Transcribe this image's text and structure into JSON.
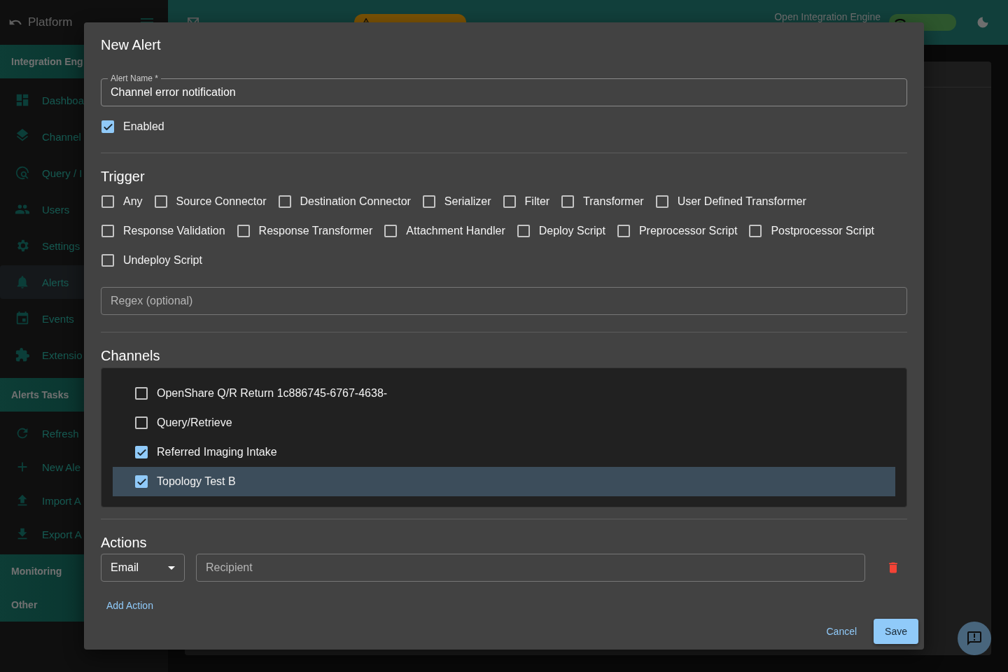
{
  "sidebar": {
    "title": "Platform",
    "sections": [
      {
        "heading": "Integration Eng",
        "items": [
          {
            "label": "Dashboa",
            "selected": false
          },
          {
            "label": "Channel",
            "selected": false
          },
          {
            "label": "Query / I",
            "selected": false
          },
          {
            "label": "Users",
            "selected": false
          },
          {
            "label": "Settings",
            "selected": false
          },
          {
            "label": "Alerts",
            "selected": true
          },
          {
            "label": "Events",
            "selected": false
          },
          {
            "label": "Extensio",
            "selected": false
          }
        ]
      },
      {
        "heading": "Alerts Tasks",
        "items": [
          {
            "label": "Refresh",
            "selected": false
          },
          {
            "label": "New Ale",
            "selected": false
          },
          {
            "label": "Import A",
            "selected": false
          },
          {
            "label": "Export A",
            "selected": false
          }
        ]
      },
      {
        "heading": "Monitoring"
      },
      {
        "heading": "Other"
      }
    ]
  },
  "topbar": {
    "engine": "Open Integration Engine"
  },
  "dialog": {
    "title": "New Alert",
    "alert_name": {
      "label": "Alert Name *",
      "value": "Channel error notification"
    },
    "enabled": {
      "label": "Enabled",
      "checked": true
    },
    "trigger": {
      "heading": "Trigger",
      "options": [
        {
          "label": "Any",
          "checked": false
        },
        {
          "label": "Source Connector",
          "checked": false
        },
        {
          "label": "Destination Connector",
          "checked": false
        },
        {
          "label": "Serializer",
          "checked": false
        },
        {
          "label": "Filter",
          "checked": false
        },
        {
          "label": "Transformer",
          "checked": false
        },
        {
          "label": "User Defined Transformer",
          "checked": false
        },
        {
          "label": "Response Validation",
          "checked": false
        },
        {
          "label": "Response Transformer",
          "checked": false
        },
        {
          "label": "Attachment Handler",
          "checked": false
        },
        {
          "label": "Deploy Script",
          "checked": false
        },
        {
          "label": "Preprocessor Script",
          "checked": false
        },
        {
          "label": "Postprocessor Script",
          "checked": false
        },
        {
          "label": "Undeploy Script",
          "checked": false
        }
      ],
      "regex_placeholder": "Regex (optional)"
    },
    "channels": {
      "heading": "Channels",
      "items": [
        {
          "label": "OpenShare Q/R Return 1c886745-6767-4638-",
          "checked": false,
          "selected": false
        },
        {
          "label": "Query/Retrieve",
          "checked": false,
          "selected": false
        },
        {
          "label": "Referred Imaging Intake",
          "checked": true,
          "selected": false
        },
        {
          "label": "Topology Test B",
          "checked": true,
          "selected": true
        }
      ]
    },
    "actions": {
      "heading": "Actions",
      "items": [
        {
          "type": "Email",
          "recipient_placeholder": "Recipient"
        }
      ],
      "add_label": "Add Action"
    },
    "buttons": {
      "cancel": "Cancel",
      "save": "Save"
    }
  }
}
